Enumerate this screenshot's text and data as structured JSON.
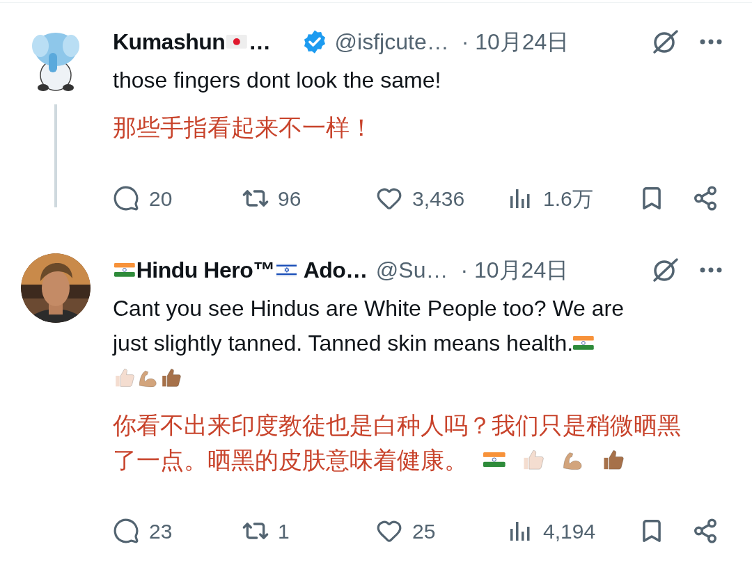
{
  "tweets": [
    {
      "avatar": {
        "kind": "cartoon"
      },
      "thread_line": true,
      "name": [
        {
          "kind": "text",
          "text": "Kumashun"
        },
        {
          "kind": "flag_jp"
        },
        {
          "kind": "text",
          "text": "…"
        }
      ],
      "verified": true,
      "handle": "@isfjcute…",
      "date": "· 10月24日",
      "text_lines": [
        [
          {
            "kind": "text",
            "text": "those fingers dont look the same!"
          }
        ]
      ],
      "translation_lines": [
        [
          {
            "kind": "text",
            "text": "那些手指看起来不一样！"
          }
        ]
      ],
      "stats": {
        "replies": "20",
        "reposts": "96",
        "likes": "3,436",
        "views": "1.6万"
      }
    },
    {
      "avatar": {
        "kind": "person"
      },
      "thread_line": false,
      "name": [
        {
          "kind": "flag_in"
        },
        {
          "kind": "text",
          "text": "Hindu Hero™"
        },
        {
          "kind": "flag_il"
        },
        {
          "kind": "text",
          "text": " Ado…"
        }
      ],
      "verified": false,
      "handle": "@Su…",
      "date": "· 10月24日",
      "text_lines": [
        [
          {
            "kind": "text",
            "text": "Cant you see Hindus are White People too? We are"
          }
        ],
        [
          {
            "kind": "text",
            "text": "just slightly tanned. Tanned skin means health."
          },
          {
            "kind": "flag_in"
          }
        ],
        [
          {
            "kind": "thumbs",
            "color": "#f4ddd0"
          },
          {
            "kind": "flex",
            "color": "#d2a47c"
          },
          {
            "kind": "thumbs",
            "color": "#a6714a"
          }
        ]
      ],
      "translation_lines": [
        [
          {
            "kind": "text",
            "text": "你看不出来印度教徒也是白种人吗？我们只是稍微晒黑"
          }
        ],
        [
          {
            "kind": "text",
            "text": "了一点。晒黑的皮肤意味着健康。"
          },
          {
            "kind": "flag_in"
          },
          {
            "kind": "thumbs",
            "color": "#f4ddd0"
          },
          {
            "kind": "flex",
            "color": "#d2a47c"
          },
          {
            "kind": "thumbs",
            "color": "#a6714a"
          }
        ]
      ],
      "stats": {
        "replies": "23",
        "reposts": "1",
        "likes": "25",
        "views": "4,194"
      }
    }
  ]
}
